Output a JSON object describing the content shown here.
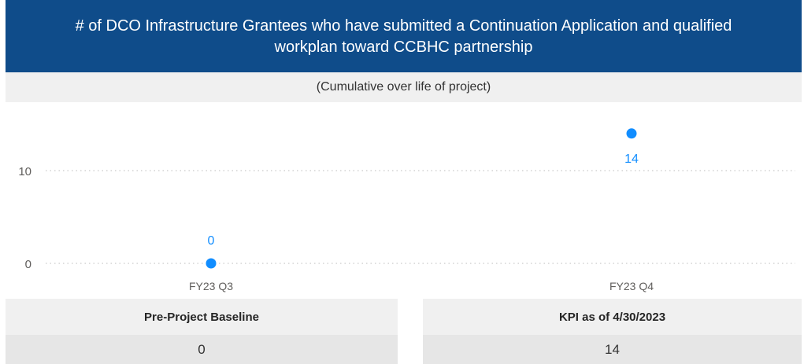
{
  "header": {
    "title": "# of DCO Infrastructure Grantees who have submitted a Continuation Application and qualified workplan toward CCBHC partnership",
    "subtitle": "(Cumulative over life of project)"
  },
  "chart_data": {
    "type": "scatter",
    "categories": [
      "FY23 Q3",
      "FY23 Q4"
    ],
    "values": [
      0,
      14
    ],
    "data_labels": [
      "0",
      "14"
    ],
    "y_ticks": [
      0,
      10
    ],
    "y_tick_labels": [
      "0",
      "10"
    ],
    "ylim": [
      0,
      14
    ],
    "grid": "dotted horizontal",
    "marker_color": "#118dff",
    "label_color": "#118dff"
  },
  "cards": [
    {
      "label": "Pre-Project Baseline",
      "value": "0"
    },
    {
      "label": "KPI as of 4/30/2023",
      "value": "14"
    }
  ],
  "colors": {
    "title_band": "#0f4c8a",
    "band_bg": "#f0f0f0",
    "value_bg": "#e6e6e6"
  }
}
